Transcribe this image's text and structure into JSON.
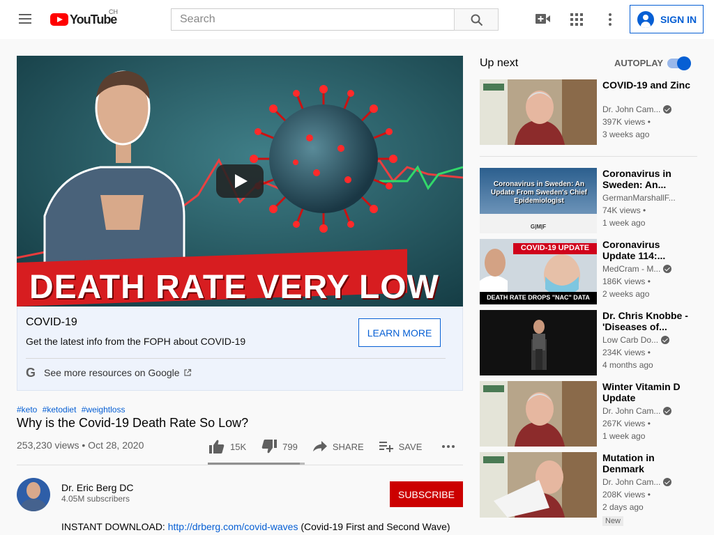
{
  "header": {
    "logo_text": "YouTube",
    "country_code": "CH",
    "search_placeholder": "Search",
    "signin_label": "SIGN IN",
    "icons": [
      "menu-icon",
      "youtube-logo",
      "search-icon",
      "video-camera-icon",
      "apps-grid-icon",
      "more-vert-icon",
      "account-icon"
    ]
  },
  "player": {
    "thumbnail_text": "DEATH RATE VERY LOW",
    "play_icon": "play-icon"
  },
  "info_panel": {
    "title": "COVID-19",
    "description": "Get the latest info from the FOPH about COVID-19",
    "button_label": "LEARN MORE",
    "google_link": "See more resources on Google"
  },
  "video": {
    "hashtags": [
      "#keto",
      "#ketodiet",
      "#weightloss"
    ],
    "title": "Why is the Covid-19 Death Rate So Low?",
    "meta": "253,230 views • Oct 28, 2020",
    "likes": "15K",
    "dislikes": "799",
    "share_label": "SHARE",
    "save_label": "SAVE",
    "like_ratio": 0.95
  },
  "channel": {
    "name": "Dr. Eric Berg DC",
    "subscribers": "4.05M subscribers",
    "subscribe_label": "SUBSCRIBE"
  },
  "description": {
    "prefix": "INSTANT DOWNLOAD: ",
    "link": "http://drberg.com/covid-waves",
    "suffix": " (Covid-19 First and Second Wave)"
  },
  "sidebar": {
    "upnext_label": "Up next",
    "autoplay_label": "AUTOPLAY",
    "autoplay_on": true,
    "items": [
      {
        "title": "COVID-19 and Zinc",
        "channel": "Dr. John Cam...",
        "verified": true,
        "views": "397K views •",
        "ago": "3 weeks ago",
        "badge": ""
      },
      {
        "title": "Coronavirus in Sweden: An...",
        "channel": "GermanMarshallF...",
        "verified": false,
        "views": "74K views •",
        "ago": "1 week ago",
        "badge": "",
        "thumb_text": "Coronavirus in Sweden: An Update From Sweden's Chief Epidemiologist",
        "thumb_footer": "G|M|F"
      },
      {
        "title": "Coronavirus Update 114:...",
        "channel": "MedCram - M...",
        "verified": true,
        "views": "186K views •",
        "ago": "2 weeks ago",
        "badge": "",
        "thumb_text": "COVID-19 UPDATE",
        "thumb_footer": "DEATH RATE DROPS \"NAC\" DATA"
      },
      {
        "title": "Dr. Chris Knobbe - 'Diseases of...",
        "channel": "Low Carb Do...",
        "verified": true,
        "views": "234K views •",
        "ago": "4 months ago",
        "badge": ""
      },
      {
        "title": "Winter Vitamin D Update",
        "channel": "Dr. John Cam...",
        "verified": true,
        "views": "267K views •",
        "ago": "1 week ago",
        "badge": ""
      },
      {
        "title": "Mutation in Denmark",
        "channel": "Dr. John Cam...",
        "verified": true,
        "views": "208K views •",
        "ago": "2 days ago",
        "badge": "New"
      }
    ]
  }
}
